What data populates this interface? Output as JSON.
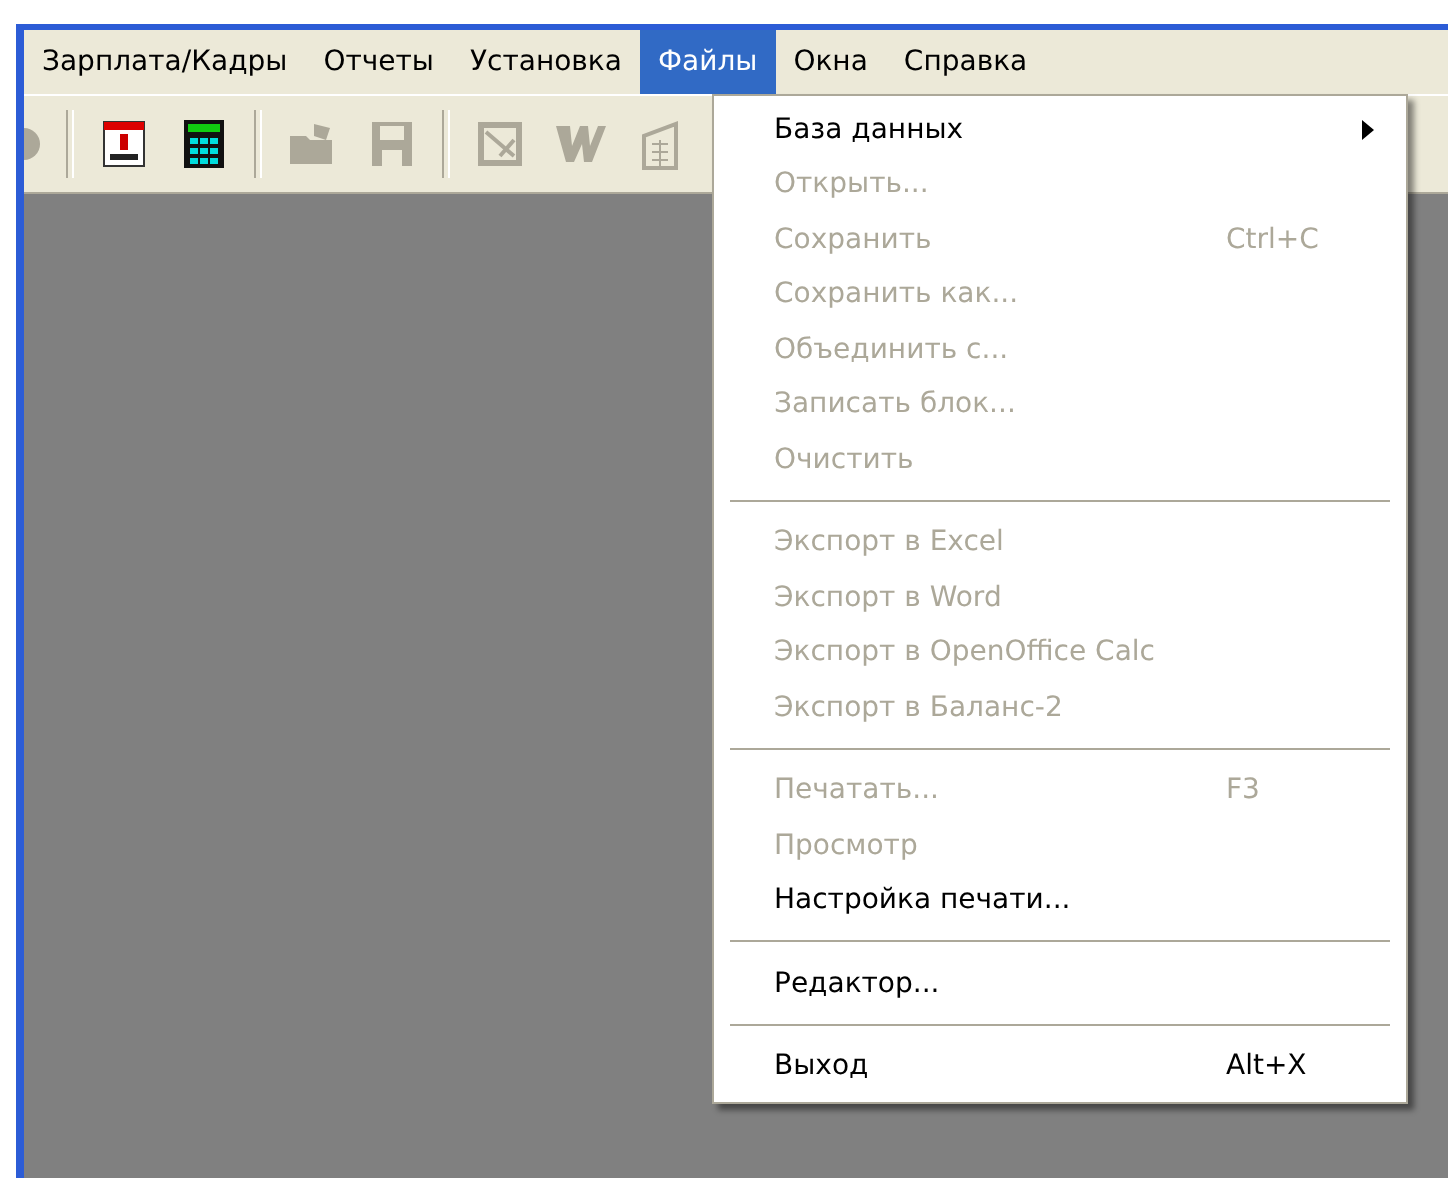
{
  "menubar": [
    {
      "label": "Зарплата/Кадры",
      "selected": false
    },
    {
      "label": "Отчеты",
      "selected": false
    },
    {
      "label": "Установка",
      "selected": false
    },
    {
      "label": "Файлы",
      "selected": true
    },
    {
      "label": "Окна",
      "selected": false
    },
    {
      "label": "Справка",
      "selected": false
    }
  ],
  "toolbar": [
    {
      "kind": "round",
      "disabled": true
    },
    {
      "kind": "separator"
    },
    {
      "kind": "calendar",
      "disabled": false
    },
    {
      "kind": "calculator",
      "disabled": false
    },
    {
      "kind": "separator"
    },
    {
      "kind": "folder",
      "disabled": true
    },
    {
      "kind": "floppy",
      "disabled": true
    },
    {
      "kind": "separator"
    },
    {
      "kind": "image",
      "disabled": true
    },
    {
      "kind": "word",
      "disabled": true
    },
    {
      "kind": "building",
      "disabled": true
    }
  ],
  "menu": [
    {
      "kind": "item",
      "label": "База данных",
      "disabled": false,
      "submenu": true
    },
    {
      "kind": "item",
      "label": "Открыть...",
      "disabled": true,
      "submenu": false
    },
    {
      "kind": "item",
      "label": "Сохранить",
      "shortcut": "Ctrl+C",
      "disabled": true,
      "submenu": false
    },
    {
      "kind": "item",
      "label": "Сохранить как...",
      "disabled": true,
      "submenu": false
    },
    {
      "kind": "item",
      "label": "Объединить с...",
      "disabled": true,
      "submenu": false
    },
    {
      "kind": "item",
      "label": "Записать блок...",
      "disabled": true,
      "submenu": false
    },
    {
      "kind": "item",
      "label": "Очистить",
      "disabled": true,
      "submenu": false
    },
    {
      "kind": "separator"
    },
    {
      "kind": "item",
      "label": "Экспорт в Excel",
      "disabled": true,
      "submenu": false
    },
    {
      "kind": "item",
      "label": "Экспорт в Word",
      "disabled": true,
      "submenu": false
    },
    {
      "kind": "item",
      "label": "Экспорт в OpenOffice Calc",
      "disabled": true,
      "submenu": false
    },
    {
      "kind": "item",
      "label": "Экспорт в Баланс-2",
      "disabled": true,
      "submenu": false
    },
    {
      "kind": "separator"
    },
    {
      "kind": "item",
      "label": "Печатать...",
      "shortcut": "F3",
      "disabled": true,
      "submenu": false
    },
    {
      "kind": "item",
      "label": "Просмотр",
      "disabled": true,
      "submenu": false
    },
    {
      "kind": "item",
      "label": "Настройка печати...",
      "disabled": false,
      "submenu": false
    },
    {
      "kind": "separator"
    },
    {
      "kind": "item",
      "label": "Редактор...",
      "disabled": false,
      "submenu": false
    },
    {
      "kind": "separator"
    },
    {
      "kind": "item",
      "label": "Выход",
      "shortcut": "Alt+X",
      "disabled": false,
      "submenu": false
    }
  ]
}
